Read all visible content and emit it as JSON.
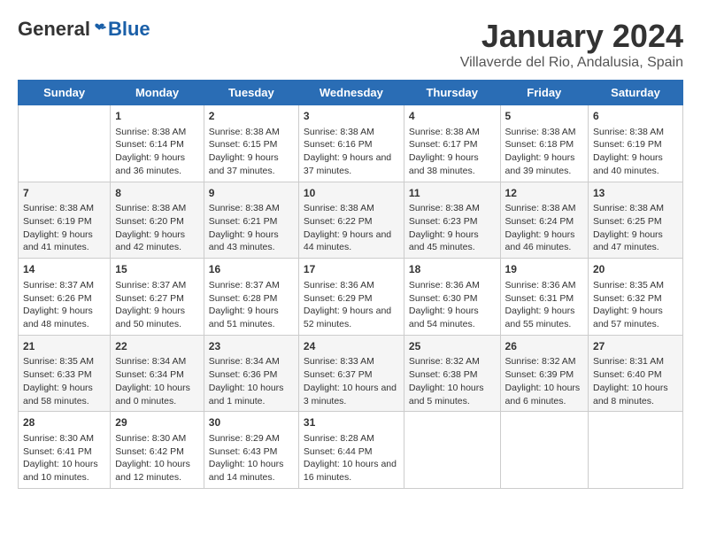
{
  "header": {
    "logo_general": "General",
    "logo_blue": "Blue",
    "title": "January 2024",
    "subtitle": "Villaverde del Rio, Andalusia, Spain"
  },
  "days_of_week": [
    "Sunday",
    "Monday",
    "Tuesday",
    "Wednesday",
    "Thursday",
    "Friday",
    "Saturday"
  ],
  "weeks": [
    [
      {
        "day": "",
        "sunrise": "",
        "sunset": "",
        "daylight": ""
      },
      {
        "day": "1",
        "sunrise": "Sunrise: 8:38 AM",
        "sunset": "Sunset: 6:14 PM",
        "daylight": "Daylight: 9 hours and 36 minutes."
      },
      {
        "day": "2",
        "sunrise": "Sunrise: 8:38 AM",
        "sunset": "Sunset: 6:15 PM",
        "daylight": "Daylight: 9 hours and 37 minutes."
      },
      {
        "day": "3",
        "sunrise": "Sunrise: 8:38 AM",
        "sunset": "Sunset: 6:16 PM",
        "daylight": "Daylight: 9 hours and 37 minutes."
      },
      {
        "day": "4",
        "sunrise": "Sunrise: 8:38 AM",
        "sunset": "Sunset: 6:17 PM",
        "daylight": "Daylight: 9 hours and 38 minutes."
      },
      {
        "day": "5",
        "sunrise": "Sunrise: 8:38 AM",
        "sunset": "Sunset: 6:18 PM",
        "daylight": "Daylight: 9 hours and 39 minutes."
      },
      {
        "day": "6",
        "sunrise": "Sunrise: 8:38 AM",
        "sunset": "Sunset: 6:19 PM",
        "daylight": "Daylight: 9 hours and 40 minutes."
      }
    ],
    [
      {
        "day": "7",
        "sunrise": "Sunrise: 8:38 AM",
        "sunset": "Sunset: 6:19 PM",
        "daylight": "Daylight: 9 hours and 41 minutes."
      },
      {
        "day": "8",
        "sunrise": "Sunrise: 8:38 AM",
        "sunset": "Sunset: 6:20 PM",
        "daylight": "Daylight: 9 hours and 42 minutes."
      },
      {
        "day": "9",
        "sunrise": "Sunrise: 8:38 AM",
        "sunset": "Sunset: 6:21 PM",
        "daylight": "Daylight: 9 hours and 43 minutes."
      },
      {
        "day": "10",
        "sunrise": "Sunrise: 8:38 AM",
        "sunset": "Sunset: 6:22 PM",
        "daylight": "Daylight: 9 hours and 44 minutes."
      },
      {
        "day": "11",
        "sunrise": "Sunrise: 8:38 AM",
        "sunset": "Sunset: 6:23 PM",
        "daylight": "Daylight: 9 hours and 45 minutes."
      },
      {
        "day": "12",
        "sunrise": "Sunrise: 8:38 AM",
        "sunset": "Sunset: 6:24 PM",
        "daylight": "Daylight: 9 hours and 46 minutes."
      },
      {
        "day": "13",
        "sunrise": "Sunrise: 8:38 AM",
        "sunset": "Sunset: 6:25 PM",
        "daylight": "Daylight: 9 hours and 47 minutes."
      }
    ],
    [
      {
        "day": "14",
        "sunrise": "Sunrise: 8:37 AM",
        "sunset": "Sunset: 6:26 PM",
        "daylight": "Daylight: 9 hours and 48 minutes."
      },
      {
        "day": "15",
        "sunrise": "Sunrise: 8:37 AM",
        "sunset": "Sunset: 6:27 PM",
        "daylight": "Daylight: 9 hours and 50 minutes."
      },
      {
        "day": "16",
        "sunrise": "Sunrise: 8:37 AM",
        "sunset": "Sunset: 6:28 PM",
        "daylight": "Daylight: 9 hours and 51 minutes."
      },
      {
        "day": "17",
        "sunrise": "Sunrise: 8:36 AM",
        "sunset": "Sunset: 6:29 PM",
        "daylight": "Daylight: 9 hours and 52 minutes."
      },
      {
        "day": "18",
        "sunrise": "Sunrise: 8:36 AM",
        "sunset": "Sunset: 6:30 PM",
        "daylight": "Daylight: 9 hours and 54 minutes."
      },
      {
        "day": "19",
        "sunrise": "Sunrise: 8:36 AM",
        "sunset": "Sunset: 6:31 PM",
        "daylight": "Daylight: 9 hours and 55 minutes."
      },
      {
        "day": "20",
        "sunrise": "Sunrise: 8:35 AM",
        "sunset": "Sunset: 6:32 PM",
        "daylight": "Daylight: 9 hours and 57 minutes."
      }
    ],
    [
      {
        "day": "21",
        "sunrise": "Sunrise: 8:35 AM",
        "sunset": "Sunset: 6:33 PM",
        "daylight": "Daylight: 9 hours and 58 minutes."
      },
      {
        "day": "22",
        "sunrise": "Sunrise: 8:34 AM",
        "sunset": "Sunset: 6:34 PM",
        "daylight": "Daylight: 10 hours and 0 minutes."
      },
      {
        "day": "23",
        "sunrise": "Sunrise: 8:34 AM",
        "sunset": "Sunset: 6:36 PM",
        "daylight": "Daylight: 10 hours and 1 minute."
      },
      {
        "day": "24",
        "sunrise": "Sunrise: 8:33 AM",
        "sunset": "Sunset: 6:37 PM",
        "daylight": "Daylight: 10 hours and 3 minutes."
      },
      {
        "day": "25",
        "sunrise": "Sunrise: 8:32 AM",
        "sunset": "Sunset: 6:38 PM",
        "daylight": "Daylight: 10 hours and 5 minutes."
      },
      {
        "day": "26",
        "sunrise": "Sunrise: 8:32 AM",
        "sunset": "Sunset: 6:39 PM",
        "daylight": "Daylight: 10 hours and 6 minutes."
      },
      {
        "day": "27",
        "sunrise": "Sunrise: 8:31 AM",
        "sunset": "Sunset: 6:40 PM",
        "daylight": "Daylight: 10 hours and 8 minutes."
      }
    ],
    [
      {
        "day": "28",
        "sunrise": "Sunrise: 8:30 AM",
        "sunset": "Sunset: 6:41 PM",
        "daylight": "Daylight: 10 hours and 10 minutes."
      },
      {
        "day": "29",
        "sunrise": "Sunrise: 8:30 AM",
        "sunset": "Sunset: 6:42 PM",
        "daylight": "Daylight: 10 hours and 12 minutes."
      },
      {
        "day": "30",
        "sunrise": "Sunrise: 8:29 AM",
        "sunset": "Sunset: 6:43 PM",
        "daylight": "Daylight: 10 hours and 14 minutes."
      },
      {
        "day": "31",
        "sunrise": "Sunrise: 8:28 AM",
        "sunset": "Sunset: 6:44 PM",
        "daylight": "Daylight: 10 hours and 16 minutes."
      },
      {
        "day": "",
        "sunrise": "",
        "sunset": "",
        "daylight": ""
      },
      {
        "day": "",
        "sunrise": "",
        "sunset": "",
        "daylight": ""
      },
      {
        "day": "",
        "sunrise": "",
        "sunset": "",
        "daylight": ""
      }
    ]
  ]
}
